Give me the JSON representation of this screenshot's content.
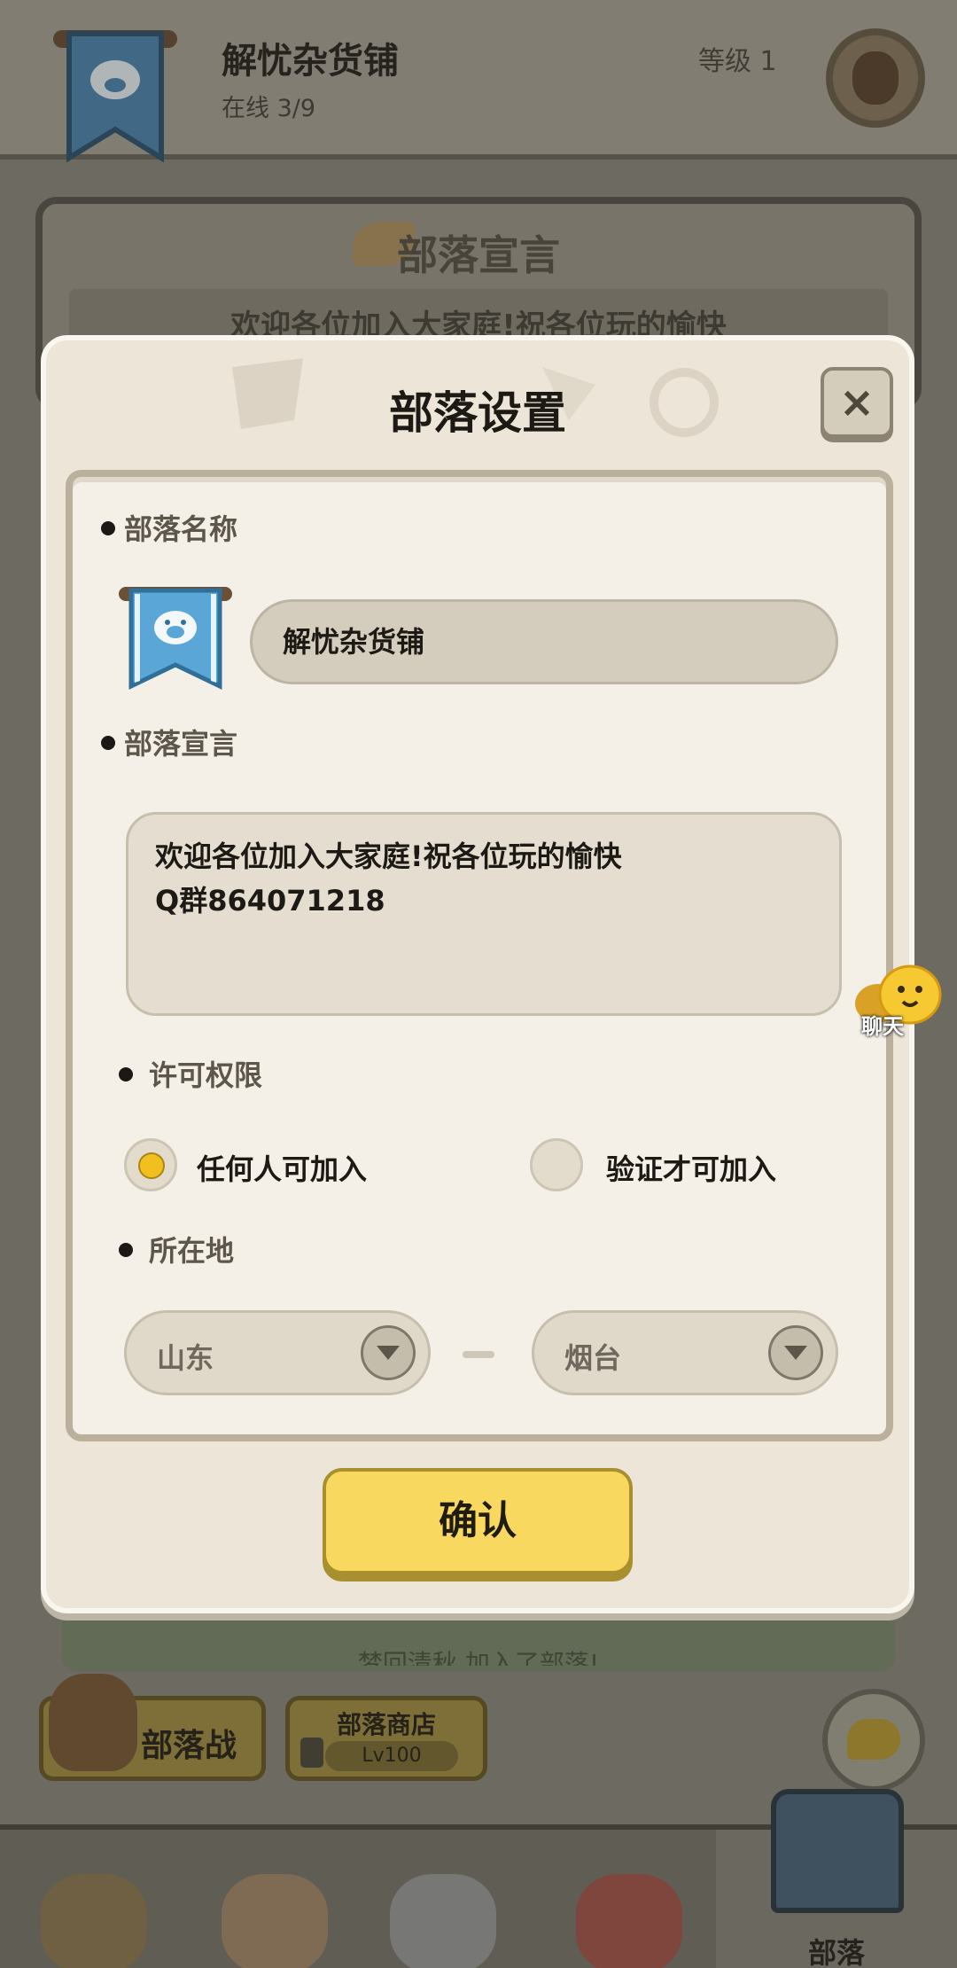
{
  "background": {
    "tribe_name": "解忧杂货铺",
    "online": "在线 3/9",
    "level": "等级 1",
    "declaration_title": "部落宣言",
    "declaration_preview": "欢迎各位加入大家庭!祝各位玩的愉快",
    "feed_message": "梦回清秋 加入了部落!",
    "tribe_war_label": "部落战",
    "tribe_shop_label": "部落商店",
    "tribe_shop_level": "Lv100",
    "bottom_nav_active_label": "部落"
  },
  "modal": {
    "title": "部落设置",
    "close_label": "×",
    "sections": {
      "name_label": "部落名称",
      "name_value": "解忧杂货铺",
      "declaration_label": "部落宣言",
      "declaration_line1": "欢迎各位加入大家庭!祝各位玩的愉快",
      "declaration_line2": "Q群864071218",
      "permission_label": "许可权限",
      "permission_option_any": "任何人可加入",
      "permission_option_verify": "验证才可加入",
      "permission_selected": "任何人可加入",
      "location_label": "所在地",
      "province": "山东",
      "city": "烟台"
    },
    "confirm_label": "确认"
  },
  "floating_chat_label": "聊天",
  "colors": {
    "accent_yellow": "#f8d85e",
    "panel_bg": "#f5f0e7",
    "modal_bg": "#ece5d8",
    "banner_blue": "#5aa6d6"
  }
}
